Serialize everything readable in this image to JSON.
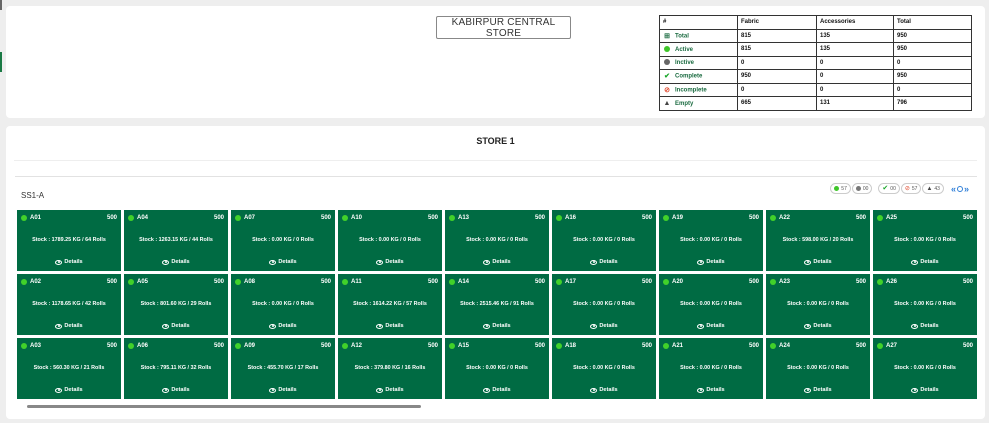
{
  "store_button": "KABIRPUR CENTRAL STORE",
  "summary": {
    "headers": [
      "#",
      "Fabric",
      "Accessories",
      "Total"
    ],
    "rows": [
      {
        "label": "Total",
        "icon": "table-icon",
        "fabric": "815",
        "accessories": "135",
        "total": "950"
      },
      {
        "label": "Active",
        "icon": "green-dot-icon",
        "fabric": "815",
        "accessories": "135",
        "total": "950"
      },
      {
        "label": "Inctive",
        "icon": "gray-dot-icon",
        "fabric": "0",
        "accessories": "0",
        "total": "0"
      },
      {
        "label": "Complete",
        "icon": "check-icon",
        "fabric": "950",
        "accessories": "0",
        "total": "950"
      },
      {
        "label": "Incomplete",
        "icon": "ban-icon",
        "fabric": "0",
        "accessories": "0",
        "total": "0"
      },
      {
        "label": "Empty",
        "icon": "warning-icon",
        "fabric": "665",
        "accessories": "131",
        "total": "796"
      }
    ]
  },
  "store_title": "STORE 1",
  "section_label": "SS1-A",
  "chips": {
    "active": "57",
    "inactive": "00",
    "complete": "00",
    "incomplete": "57",
    "empty": "43"
  },
  "colors": {
    "tile": "#006b43",
    "active": "#41d12a",
    "pager": "#2f7fd8"
  },
  "tiles": [
    {
      "name": "A01",
      "cap": "500",
      "stock": "Stock : 1789.25 KG / 64 Rolls",
      "details": "Details"
    },
    {
      "name": "A04",
      "cap": "500",
      "stock": "Stock : 1263.15 KG / 44 Rolls",
      "details": "Details"
    },
    {
      "name": "A07",
      "cap": "500",
      "stock": "Stock : 0.00 KG / 0 Rolls",
      "details": "Details"
    },
    {
      "name": "A10",
      "cap": "500",
      "stock": "Stock : 0.00 KG / 0 Rolls",
      "details": "Details"
    },
    {
      "name": "A13",
      "cap": "500",
      "stock": "Stock : 0.00 KG / 0 Rolls",
      "details": "Details"
    },
    {
      "name": "A16",
      "cap": "500",
      "stock": "Stock : 0.00 KG / 0 Rolls",
      "details": "Details"
    },
    {
      "name": "A19",
      "cap": "500",
      "stock": "Stock : 0.00 KG / 0 Rolls",
      "details": "Details"
    },
    {
      "name": "A22",
      "cap": "500",
      "stock": "Stock : 598.00 KG / 20 Rolls",
      "details": "Details"
    },
    {
      "name": "A25",
      "cap": "500",
      "stock": "Stock : 0.00 KG / 0 Rolls",
      "details": "Details"
    },
    {
      "name": "A02",
      "cap": "500",
      "stock": "Stock : 1178.65 KG / 42 Rolls",
      "details": "Details"
    },
    {
      "name": "A05",
      "cap": "500",
      "stock": "Stock : 801.60 KG / 29 Rolls",
      "details": "Details"
    },
    {
      "name": "A08",
      "cap": "500",
      "stock": "Stock : 0.00 KG / 0 Rolls",
      "details": "Details"
    },
    {
      "name": "A11",
      "cap": "500",
      "stock": "Stock : 1614.22 KG / 57 Rolls",
      "details": "Details"
    },
    {
      "name": "A14",
      "cap": "500",
      "stock": "Stock : 2515.46 KG / 91 Rolls",
      "details": "Details"
    },
    {
      "name": "A17",
      "cap": "500",
      "stock": "Stock : 0.00 KG / 0 Rolls",
      "details": "Details"
    },
    {
      "name": "A20",
      "cap": "500",
      "stock": "Stock : 0.00 KG / 0 Rolls",
      "details": "Details"
    },
    {
      "name": "A23",
      "cap": "500",
      "stock": "Stock : 0.00 KG / 0 Rolls",
      "details": "Details"
    },
    {
      "name": "A26",
      "cap": "500",
      "stock": "Stock : 0.00 KG / 0 Rolls",
      "details": "Details"
    },
    {
      "name": "A03",
      "cap": "500",
      "stock": "Stock : 560.30 KG / 21 Rolls",
      "details": "Details"
    },
    {
      "name": "A06",
      "cap": "500",
      "stock": "Stock : 795.11 KG / 32 Rolls",
      "details": "Details"
    },
    {
      "name": "A09",
      "cap": "500",
      "stock": "Stock : 455.70 KG / 17 Rolls",
      "details": "Details"
    },
    {
      "name": "A12",
      "cap": "500",
      "stock": "Stock : 379.80 KG / 16 Rolls",
      "details": "Details"
    },
    {
      "name": "A15",
      "cap": "500",
      "stock": "Stock : 0.00 KG / 0 Rolls",
      "details": "Details"
    },
    {
      "name": "A18",
      "cap": "500",
      "stock": "Stock : 0.00 KG / 0 Rolls",
      "details": "Details"
    },
    {
      "name": "A21",
      "cap": "500",
      "stock": "Stock : 0.00 KG / 0 Rolls",
      "details": "Details"
    },
    {
      "name": "A24",
      "cap": "500",
      "stock": "Stock : 0.00 KG / 0 Rolls",
      "details": "Details"
    },
    {
      "name": "A27",
      "cap": "500",
      "stock": "Stock : 0.00 KG / 0 Rolls",
      "details": "Details"
    }
  ]
}
